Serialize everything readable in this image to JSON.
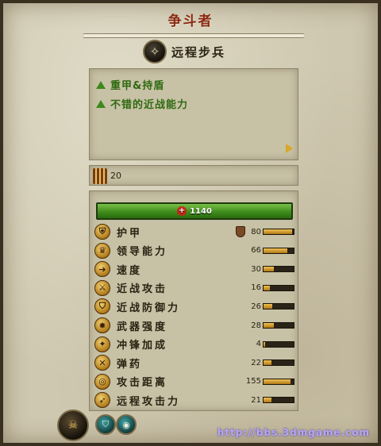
{
  "panel": {
    "title": "争斗者",
    "unit_type": "远程步兵"
  },
  "traits": [
    {
      "text": "重甲&持盾"
    },
    {
      "text": "不错的近战能力"
    }
  ],
  "ammo": {
    "value": "20"
  },
  "health": {
    "value": "1140"
  },
  "stats": [
    {
      "name": "护甲",
      "value": "80",
      "fill": 0.95,
      "icon": "armor-icon",
      "glyph": "⛨"
    },
    {
      "name": "领导能力",
      "value": "66",
      "fill": 0.78,
      "icon": "leadership-icon",
      "glyph": "♛"
    },
    {
      "name": "速度",
      "value": "30",
      "fill": 0.35,
      "icon": "speed-icon",
      "glyph": "➔"
    },
    {
      "name": "近战攻击",
      "value": "16",
      "fill": 0.2,
      "icon": "melee-attack-icon",
      "glyph": "⚔"
    },
    {
      "name": "近战防御力",
      "value": "26",
      "fill": 0.3,
      "icon": "melee-defence-icon",
      "glyph": "⛉"
    },
    {
      "name": "武器强度",
      "value": "28",
      "fill": 0.33,
      "icon": "weapon-strength-icon",
      "glyph": "✸"
    },
    {
      "name": "冲锋加成",
      "value": "4",
      "fill": 0.05,
      "icon": "charge-bonus-icon",
      "glyph": "✦"
    },
    {
      "name": "弹药",
      "value": "22",
      "fill": 0.26,
      "icon": "ammunition-icon",
      "glyph": "✕"
    },
    {
      "name": "攻击距离",
      "value": "155",
      "fill": 0.9,
      "icon": "range-icon",
      "glyph": "◎"
    },
    {
      "name": "远程攻击力",
      "value": "21",
      "fill": 0.25,
      "icon": "missile-damage-icon",
      "glyph": "➶"
    }
  ],
  "watermark": "http://bbs.3dmgame.com"
}
